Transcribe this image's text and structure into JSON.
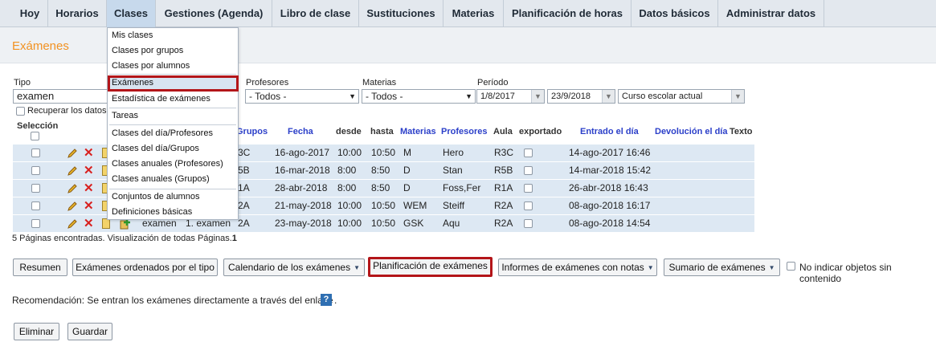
{
  "nav": {
    "items": [
      "Hoy",
      "Horarios",
      "Clases",
      "Gestiones (Agenda)",
      "Libro de clase",
      "Sustituciones",
      "Materias",
      "Planificación de horas",
      "Datos básicos",
      "Administrar datos"
    ]
  },
  "page": {
    "title": "Exámenes"
  },
  "filters": {
    "tipo_label": "Tipo",
    "tipo_value": "examen",
    "profesores_label": "Profesores",
    "profesores_value": "- Todos -",
    "materias_label": "Materias",
    "materias_value": "- Todos -",
    "periodo_label": "Período",
    "date_from": "1/8/2017",
    "date_to": "23/9/2018",
    "curso_value": "Curso escolar actual",
    "recuperar_label": "Recuperar los datos"
  },
  "table": {
    "seleccion_header": "Selección",
    "headers": [
      "Grupos",
      "Fecha",
      "desde",
      "hasta",
      "Materias",
      "Profesores",
      "Aula",
      "exportado",
      "Entrado el día",
      "Devolución el día",
      "Texto"
    ],
    "rows": [
      {
        "grupo": "3C",
        "fecha": "16-ago-2017",
        "desde": "10:00",
        "hasta": "10:50",
        "materia": "M",
        "profesor": "Hero",
        "aula": "R3C",
        "entrado": "14-ago-2017 16:46"
      },
      {
        "grupo": "5B",
        "fecha": "16-mar-2018",
        "desde": "8:00",
        "hasta": "8:50",
        "materia": "D",
        "profesor": "Stan",
        "aula": "R5B",
        "entrado": "14-mar-2018 15:42"
      },
      {
        "grupo": "1A",
        "fecha": "28-abr-2018",
        "desde": "8:00",
        "hasta": "8:50",
        "materia": "D",
        "profesor": "Foss,Fer",
        "aula": "R1A",
        "entrado": "26-abr-2018 16:43"
      },
      {
        "grupo": "2A",
        "fecha": "21-may-2018",
        "desde": "10:00",
        "hasta": "10:50",
        "materia": "WEM",
        "profesor": "Steiff",
        "aula": "R2A",
        "entrado": "08-ago-2018 16:17"
      },
      {
        "grupo": "2A",
        "fecha": "23-may-2018",
        "desde": "10:00",
        "hasta": "10:50",
        "materia": "GSK",
        "profesor": "Aqu",
        "aula": "R2A",
        "entrado": "08-ago-2018 14:54",
        "tipo": "examen",
        "nombre": "1. examen"
      }
    ],
    "footer_text": "5 Páginas encontradas. Visualización de todas Páginas.",
    "footer_count": "1"
  },
  "menu": {
    "groups": [
      [
        "Mis clases",
        "Clases por grupos",
        "Clases por alumnos"
      ],
      [
        "Exámenes",
        "Estadística de exámenes"
      ],
      [
        "Tareas"
      ],
      [
        "Clases del día/Profesores",
        "Clases del día/Grupos",
        "Clases anuales (Profesores)",
        "Clases anuales (Grupos)"
      ],
      [
        "Conjuntos de alumnos",
        "Definiciones básicas"
      ]
    ]
  },
  "buttons": {
    "resumen": "Resumen",
    "ordenados": "Exámenes ordenados por el tipo",
    "calendario": "Calendario de los exámenes",
    "planificacion": "Planificación de exámenes",
    "informes": "Informes de exámenes con notas",
    "sumario": "Sumario de exámenes",
    "no_indicar": "No indicar objetos sin contenido",
    "eliminar": "Eliminar",
    "guardar": "Guardar"
  },
  "recommendation": {
    "text": "Recomendación: Se entran los exámenes directamente a través del enlace",
    "suffix": "."
  },
  "colors": {
    "title": "#f29222",
    "highlight": "#b31519",
    "row_bg": "#dde8f3",
    "link": "#2b3fc9"
  }
}
